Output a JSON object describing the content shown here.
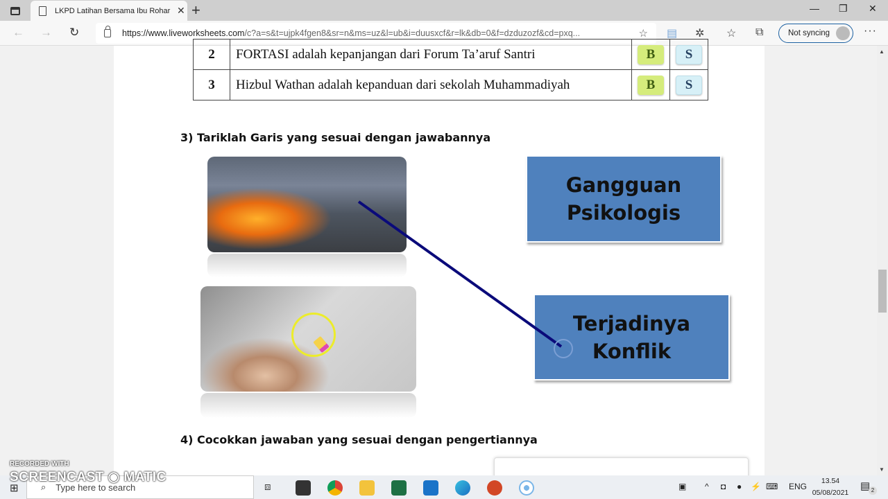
{
  "browser": {
    "tab_title": "LKPD Latihan Bersama Ibu Rohar",
    "url_domain": "https://www.liveworksheets.com",
    "url_path": "/c?a=s&t=ujpk4fgen8&sr=n&ms=uz&l=ub&i=duusxcf&r=lk&db=0&f=dzduzozf&cd=pxq...",
    "sync_label": "Not syncing",
    "new_tab_glyph": "+",
    "close_tab_glyph": "✕",
    "minimize_glyph": "—",
    "restore_glyph": "❐",
    "close_glyph": "✕",
    "back_glyph": "←",
    "forward_glyph": "→",
    "reload_glyph": "↻",
    "more_glyph": "···"
  },
  "worksheet": {
    "table_rows": [
      {
        "num": "2",
        "statement": "FORTASI adalah kepanjangan dari Forum Ta’aruf Santri",
        "option_b": "B",
        "option_s": "S"
      },
      {
        "num": "3",
        "statement": "Hizbul Wathan adalah kepanduan dari sekolah Muhammadiyah",
        "option_b": "B",
        "option_s": "S"
      }
    ],
    "question3": {
      "heading": "3)  Tariklah Garis yang sesuai dengan jawabannya",
      "images": [
        {
          "label": "riot-fire-image",
          "description": "Crowd riot with fire on street"
        },
        {
          "label": "stressed-man-image",
          "description": "Man holding head with tangled lines"
        }
      ],
      "answers": [
        {
          "line1": "Gangguan",
          "line2": "Psikologis"
        },
        {
          "line1": "Terjadinya",
          "line2": "Konflik"
        }
      ],
      "line_color": "#0a0a7a",
      "connected": {
        "from_image": "riot-fire-image",
        "to_answer": "Terjadinya Konflik"
      }
    },
    "question4": {
      "heading": "4)  Cocokkan jawaban yang sesuai dengan pengertiannya"
    }
  },
  "colors": {
    "answer_box": "#4f81bd",
    "btn_b": "#d5ec7c",
    "btn_s": "#d7f0f7",
    "sync_border": "#1a5fa0"
  },
  "taskbar": {
    "search_placeholder": "Type here to search",
    "language": "ENG",
    "time": "13.54",
    "date": "05/08/2021",
    "notification_count": "2"
  },
  "watermark": {
    "line1": "RECORDED WITH",
    "line2": "SCREENCAST ◉ MATIC"
  }
}
